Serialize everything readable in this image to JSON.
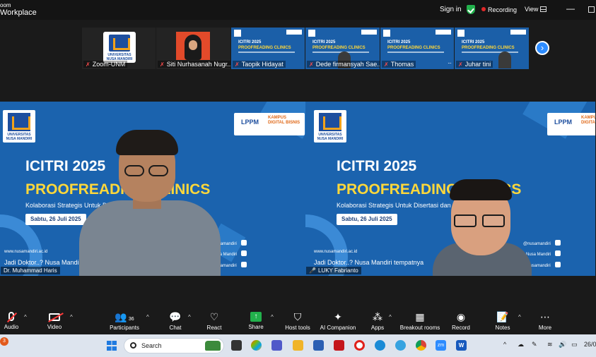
{
  "titlebar": {
    "app_line1": "oom",
    "app_line2": "Workplace",
    "signin": "Sign in",
    "recording": "Recording",
    "view": "View",
    "minimize": "—"
  },
  "gallery": {
    "tiles": [
      {
        "name": "Zoom-UNM",
        "logo_text": "UNIVERSITAS NUSA MANDIRI"
      },
      {
        "name": "Siti Nurhasanah Nugr..."
      },
      {
        "name": "Taopik Hidayat",
        "slide_title": "ICITRI 2025",
        "slide_title2": "PROOFREADING CLINICS"
      },
      {
        "name": "Dede firmansyah Sae...",
        "slide_title": "ICITRI 2025",
        "slide_title2": "PROOFREADING CLINICS"
      },
      {
        "name": "Thomas",
        "slide_title": "ICITRI 2025",
        "slide_title2": "PROOFREADING CLINICS"
      },
      {
        "name": "Juhar tini",
        "slide_title": "ICITRI 2025",
        "slide_title2": "PROOFREADING CLINICS"
      }
    ],
    "next_arrow": "›",
    "more": "···"
  },
  "videos": [
    {
      "name": "Dr. Muhammad Haris",
      "logo_text": "UNIVERSITAS NUSA MANDIRI",
      "badge_lppm": "LPPM",
      "badge_kampus": "KAMPUS DIGITAL BISNIS",
      "title": "ICITRI 2025",
      "title2": "PROOFREADING CLINICS",
      "subtitle": "Kolaborasi Strategis Untuk Disertasi dan Publikasi Global",
      "date": "Sabtu, 26 Juli 2025",
      "url": "www.nusamandiri.ac.id",
      "tagline": "Jadi Doktor..? Nusa Mandiri tempatnya",
      "social1": "@nusamandiri",
      "social2": "Nusa Mandiri",
      "social3": "nusamandiri"
    },
    {
      "name": "LUKY Fabrianto",
      "logo_text": "UNIVERSITAS NUSA MANDIRI",
      "badge_lppm": "LPPM",
      "badge_kampus": "KAMPUS DIGITAL BISNIS",
      "title": "ICITRI 2025",
      "title2": "PROOFREADING CLINICS",
      "subtitle": "Kolaborasi Strategis Untuk Disertasi dan Publikasi Global",
      "date": "Sabtu, 26 Juli 2025",
      "url": "www.nusamandiri.ac.id",
      "tagline": "Jadi Doktor..? Nusa Mandiri tempatnya",
      "social1": "@nusamandiri",
      "social2": "Nusa Mandiri",
      "social3": "nusamandiri"
    }
  ],
  "toolbar": {
    "audio": "Audio",
    "video": "Video",
    "participants": "Participants",
    "participants_count": "36",
    "chat": "Chat",
    "react": "React",
    "share": "Share",
    "host_tools": "Host tools",
    "ai_companion": "AI Companion",
    "apps": "Apps",
    "breakout_rooms": "Breakout rooms",
    "record": "Record",
    "notes": "Notes",
    "more": "More"
  },
  "taskbar": {
    "notification_count": "3",
    "search_label": "Search",
    "date": "26/0",
    "zoom_label": "zm",
    "word_label": "W"
  },
  "colors": {
    "slide_blue": "#1b63ae",
    "accent_yellow": "#ffd83a",
    "zoom_blue": "#2d8cff",
    "recording_red": "#e02828",
    "share_green": "#22b14c"
  }
}
